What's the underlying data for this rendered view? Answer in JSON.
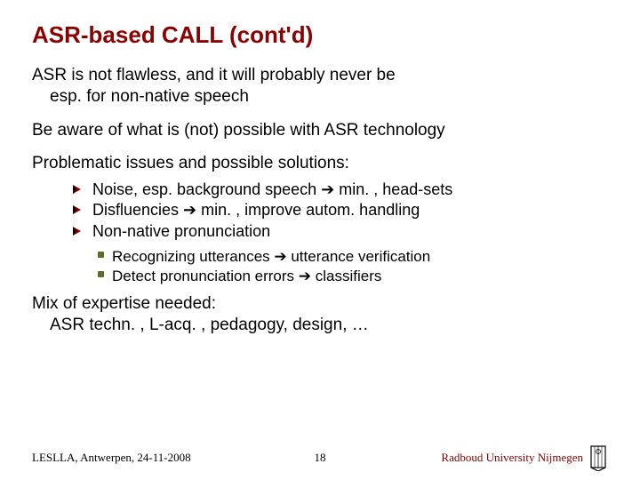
{
  "title": "ASR-based CALL (cont'd)",
  "para1_line1": "ASR is not flawless, and it will probably never be",
  "para1_line2": "esp. for non-native speech",
  "para2": "Be aware of what is (not) possible with ASR technology",
  "para3": "Problematic issues and possible solutions:",
  "bullets": [
    "Noise, esp. background speech ➔ min. , head-sets",
    "Disfluencies ➔ min. , improve autom. handling",
    "Non-native pronunciation"
  ],
  "subbullets": [
    "Recognizing utterances ➔ utterance verification",
    "Detect pronunciation errors ➔ classifiers"
  ],
  "para4_line1": "Mix of expertise needed:",
  "para4_line2": "ASR techn. , L-acq. , pedagogy, design, …",
  "footer": {
    "left": "LESLLA, Antwerpen, 24-11-2008",
    "center": "18",
    "right": "Radboud University Nijmegen"
  }
}
